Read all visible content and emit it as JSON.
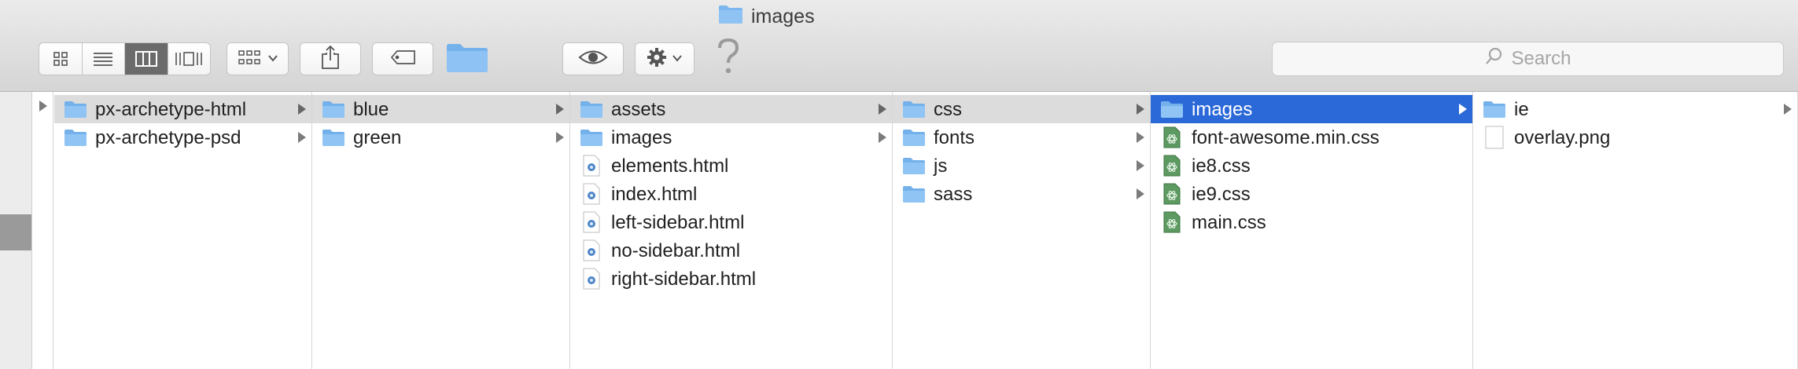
{
  "window": {
    "title": "images",
    "title_icon": "folder-icon"
  },
  "toolbar": {
    "view_buttons": [
      "icon-view-icon",
      "list-view-icon",
      "column-view-icon",
      "cover-flow-icon"
    ],
    "active_view": "column-view-icon",
    "arrange_icon": "arrange-grid-icon",
    "share_icon": "share-icon",
    "tags_icon": "tag-icon",
    "new_folder_icon": "folder-icon",
    "quicklook_icon": "eye-icon",
    "action_icon": "gear-icon",
    "help_icon": "question-mark-icon"
  },
  "search": {
    "placeholder": "Search"
  },
  "colors": {
    "selection": "#2c69d8",
    "folder": "#7bb6ee",
    "css_icon": "#5d9a62"
  },
  "columns": [
    {
      "items": [
        {
          "label": "px-archetype-html",
          "type": "folder",
          "has_children": true,
          "state": "path"
        },
        {
          "label": "px-archetype-psd",
          "type": "folder",
          "has_children": true,
          "state": "none"
        }
      ]
    },
    {
      "items": [
        {
          "label": "blue",
          "type": "folder",
          "has_children": true,
          "state": "path"
        },
        {
          "label": "green",
          "type": "folder",
          "has_children": true,
          "state": "none"
        }
      ]
    },
    {
      "items": [
        {
          "label": "assets",
          "type": "folder",
          "has_children": true,
          "state": "path"
        },
        {
          "label": "images",
          "type": "folder",
          "has_children": true,
          "state": "none"
        },
        {
          "label": "elements.html",
          "type": "html",
          "has_children": false,
          "state": "none"
        },
        {
          "label": "index.html",
          "type": "html",
          "has_children": false,
          "state": "none"
        },
        {
          "label": "left-sidebar.html",
          "type": "html",
          "has_children": false,
          "state": "none"
        },
        {
          "label": "no-sidebar.html",
          "type": "html",
          "has_children": false,
          "state": "none"
        },
        {
          "label": "right-sidebar.html",
          "type": "html",
          "has_children": false,
          "state": "none"
        }
      ]
    },
    {
      "items": [
        {
          "label": "css",
          "type": "folder",
          "has_children": true,
          "state": "path"
        },
        {
          "label": "fonts",
          "type": "folder",
          "has_children": true,
          "state": "none"
        },
        {
          "label": "js",
          "type": "folder",
          "has_children": true,
          "state": "none"
        },
        {
          "label": "sass",
          "type": "folder",
          "has_children": true,
          "state": "none"
        }
      ]
    },
    {
      "items": [
        {
          "label": "images",
          "type": "folder",
          "has_children": true,
          "state": "selected"
        },
        {
          "label": "font-awesome.min.css",
          "type": "css",
          "has_children": false,
          "state": "none"
        },
        {
          "label": "ie8.css",
          "type": "css",
          "has_children": false,
          "state": "none"
        },
        {
          "label": "ie9.css",
          "type": "css",
          "has_children": false,
          "state": "none"
        },
        {
          "label": "main.css",
          "type": "css",
          "has_children": false,
          "state": "none"
        }
      ]
    },
    {
      "items": [
        {
          "label": "ie",
          "type": "folder",
          "has_children": true,
          "state": "none"
        },
        {
          "label": "overlay.png",
          "type": "png",
          "has_children": false,
          "state": "none"
        }
      ]
    }
  ]
}
